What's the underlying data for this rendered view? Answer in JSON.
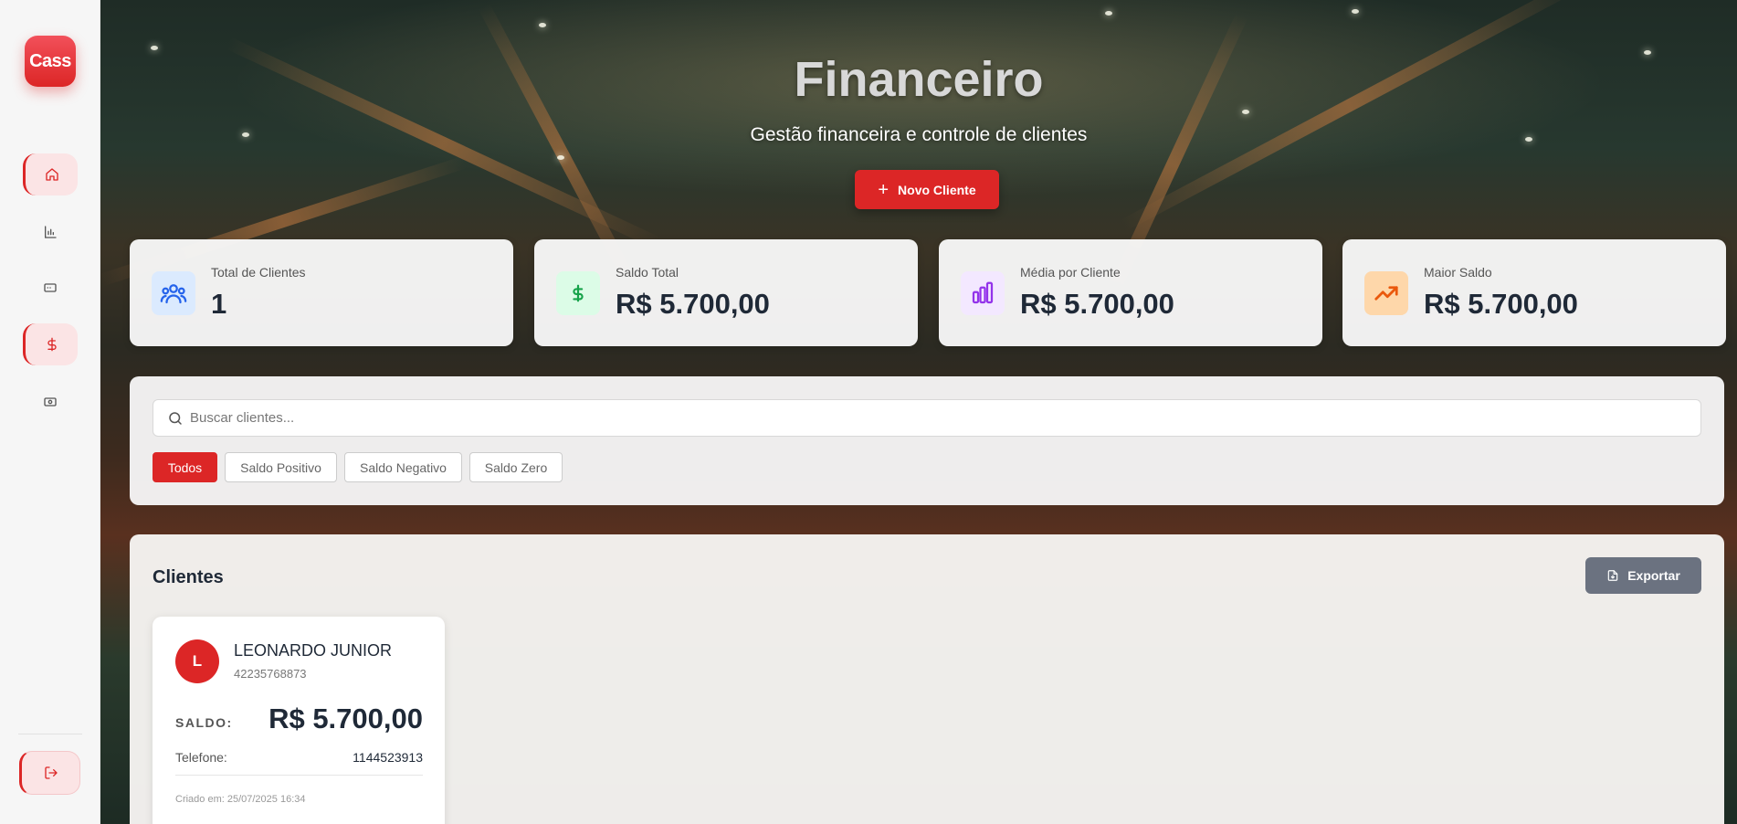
{
  "sidebar": {
    "logo": "Cass",
    "nav": [
      {
        "icon": "home-icon",
        "active": true
      },
      {
        "icon": "bar-chart-icon",
        "active": false
      },
      {
        "icon": "card-icon",
        "active": false
      },
      {
        "icon": "dollar-icon",
        "active": true
      },
      {
        "icon": "cash-icon",
        "active": false
      }
    ],
    "logout_icon": "logout-icon"
  },
  "header": {
    "title": "Financeiro",
    "subtitle": "Gestão financeira e controle de clientes",
    "new_client_label": "Novo Cliente"
  },
  "stats": [
    {
      "label": "Total de Clientes",
      "value": "1",
      "icon": "users-icon",
      "color": "#2563eb",
      "bg": "#dbeafe"
    },
    {
      "label": "Saldo Total",
      "value": "R$ 5.700,00",
      "icon": "dollar-icon",
      "color": "#16a34a",
      "bg": "#dcfce7"
    },
    {
      "label": "Média por Cliente",
      "value": "R$ 5.700,00",
      "icon": "bar-chart-icon",
      "color": "#9333ea",
      "bg": "#f3e8ff"
    },
    {
      "label": "Maior Saldo",
      "value": "R$ 5.700,00",
      "icon": "trending-up-icon",
      "color": "#ea580c",
      "bg": "#fed7aa"
    }
  ],
  "filters": {
    "search_placeholder": "Buscar clientes...",
    "search_value": "",
    "chips": [
      "Todos",
      "Saldo Positivo",
      "Saldo Negativo",
      "Saldo Zero"
    ],
    "active_chip": "Todos"
  },
  "clients": {
    "title": "Clientes",
    "export_label": "Exportar",
    "items": [
      {
        "initial": "L",
        "name": "LEONARDO JUNIOR",
        "document": "42235768873",
        "balance_label": "SALDO:",
        "balance": "R$ 5.700,00",
        "phone_label": "Telefone:",
        "phone": "1144523913",
        "created": "Criado em: 25/07/2025 16:34"
      }
    ]
  },
  "colors": {
    "accent": "#dc2626",
    "export": "#6b7280"
  }
}
